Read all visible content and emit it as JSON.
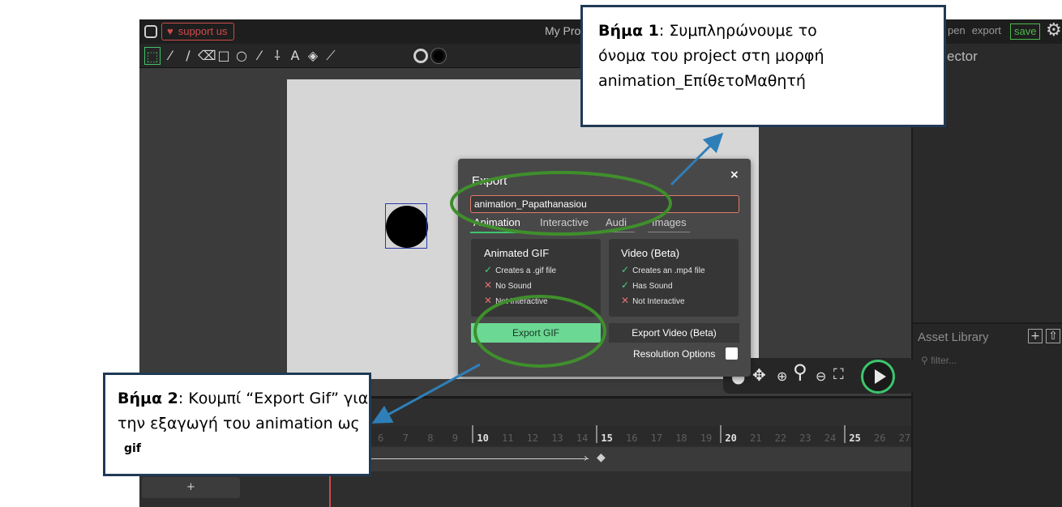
{
  "app": {
    "support_label": "support us",
    "heart_icon": "heart-icon",
    "title": "My Pro",
    "top_right": {
      "open": "pen",
      "export": "export",
      "save": "save"
    },
    "inspector_title": "ector",
    "asset_library": {
      "title": "Asset Library",
      "filter_placeholder": "filter..."
    }
  },
  "toolbar": {
    "icons": [
      "cursor-icon",
      "brush-icon",
      "pencil-icon",
      "eraser-icon",
      "rectangle-icon",
      "ellipse-icon",
      "line-icon",
      "path-icon",
      "text-icon",
      "fill-bucket-icon",
      "eyedropper-icon"
    ],
    "glyphs": [
      "⬚",
      "⁄",
      "∕",
      "⌫",
      "□",
      "○",
      "⁄",
      "⸸",
      "A",
      "◈",
      "⟋"
    ]
  },
  "playback": {
    "icons": [
      "pan-icon",
      "zoom-in-icon",
      "zoom-icon",
      "zoom-out-icon",
      "fit-icon",
      "play-icon"
    ]
  },
  "timeline": {
    "frames": [
      "6",
      "7",
      "8",
      "9",
      "10",
      "11",
      "12",
      "13",
      "14",
      "15",
      "16",
      "17",
      "18",
      "19",
      "20",
      "21",
      "22",
      "23",
      "24",
      "25",
      "26",
      "27"
    ],
    "major_frames": [
      "10",
      "15",
      "20",
      "25"
    ],
    "add_layer": "+"
  },
  "export_dialog": {
    "title": "Export",
    "close": "×",
    "filename": "animation_Papathanasiou",
    "tabs": [
      "Animation",
      "Interactive",
      "Audio",
      "Images"
    ],
    "tabs_visible": [
      "Animation",
      "Interactive",
      "Audi",
      "Images"
    ],
    "gif": {
      "title": "Animated GIF",
      "features": [
        {
          "ok": true,
          "text": "Creates a .gif file"
        },
        {
          "ok": false,
          "text": "No Sound"
        },
        {
          "ok": false,
          "text": "Not Interactive"
        }
      ],
      "button": "Export GIF"
    },
    "video": {
      "title": "Video (Beta)",
      "features": [
        {
          "ok": true,
          "text": "Creates an .mp4 file"
        },
        {
          "ok": true,
          "text": "Has Sound"
        },
        {
          "ok": false,
          "text": "Not Interactive"
        }
      ],
      "button": "Export Video (Beta)"
    },
    "resolution_label": "Resolution Options"
  },
  "callouts": {
    "step1": {
      "bold": "Βήμα 1",
      "line1": ": Συμπληρώνουμε το",
      "line2": "όνομα του project στη μορφή",
      "line3": "animation_ΕπίθετοΜαθητή"
    },
    "step2": {
      "bold": "Βήμα 2",
      "line1": ": Κουμπί “Export Gif” για",
      "line2": "την εξαγωγή του animation ως",
      "line3": "gif"
    }
  },
  "colors": {
    "annotation_green": "#3f8f2c",
    "arrow_blue": "#2e7fb8",
    "callout_border": "#1f3a55",
    "accent_green": "#3cc66d",
    "gif_button": "#6bd894"
  }
}
